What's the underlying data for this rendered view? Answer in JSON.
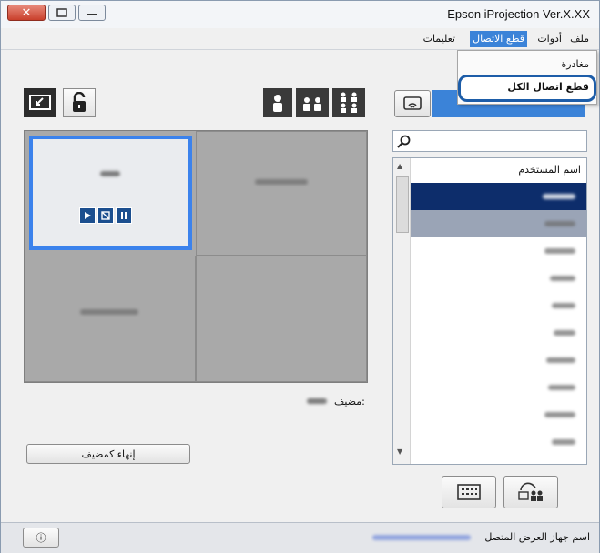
{
  "window": {
    "title": "Epson iProjection Ver.X.XX",
    "close_glyph": "✕"
  },
  "menubar": {
    "file": "ملف",
    "tools": "أدوات",
    "disconnect": "قطع الاتصال",
    "help": "تعليمات"
  },
  "disconnect_menu": {
    "leave": "مغادرة",
    "disconnect_all": "قطع اتصال الكل"
  },
  "user_list": {
    "header": "اسم المستخدم",
    "row_count": 11,
    "selected_rows": [
      0,
      1
    ]
  },
  "moderator": {
    "label": "مضيف:",
    "end_button": "إنهاء كمضيف"
  },
  "status": {
    "connected_label": "اسم جهاز العرض المتصل",
    "info_glyph": "ⓘ"
  },
  "colors": {
    "accent_blue": "#3b83d8",
    "selected_row": "#0d2d6b",
    "selected_row_2": "#9aa4b6",
    "tile_gray": "#a9a9a9",
    "tile_highlight": "#3b82ec",
    "highlight_ring": "#1d5da8"
  },
  "icons": {
    "layout_1": "single-person-icon",
    "layout_2": "two-persons-icon",
    "layout_4": "four-persons-icon",
    "exit_fullscreen": "exit-fullscreen-icon",
    "lock": "unlock-icon",
    "projector": "projector-wifi-icon",
    "search": "search-icon",
    "play": "play-icon",
    "stop": "stop-icon",
    "pause": "pause-icon",
    "keyboard": "keyboard-icon",
    "share": "share-users-icon"
  }
}
